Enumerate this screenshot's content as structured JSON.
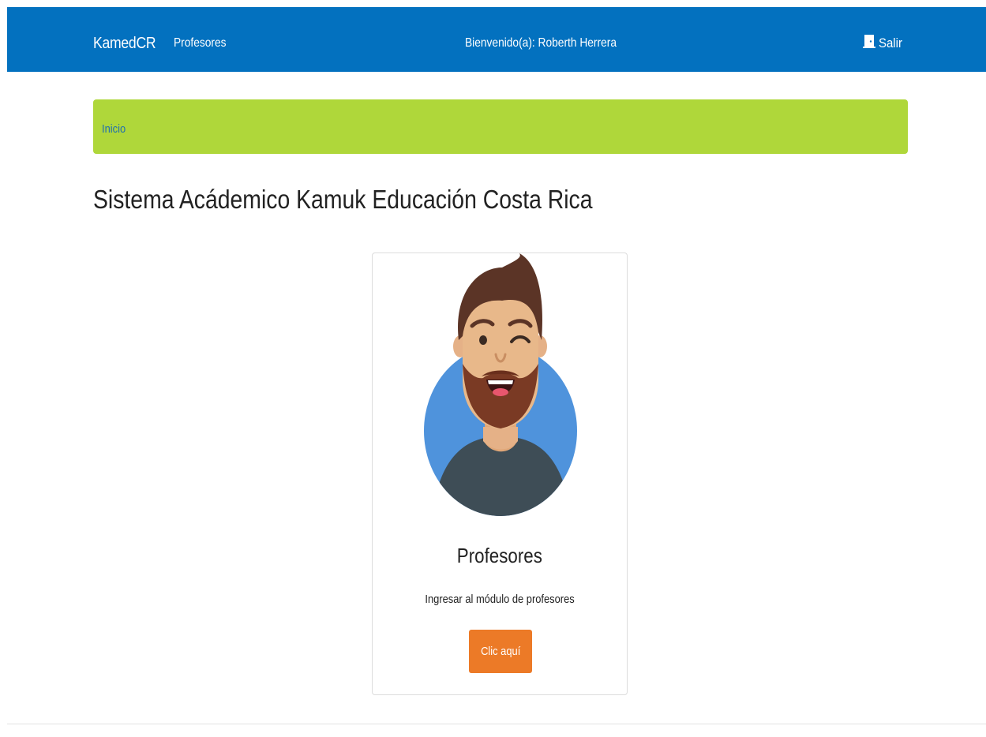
{
  "navbar": {
    "brand": "KamedCR",
    "link": "Profesores",
    "welcome": "Bienvenido(a): Roberth Herrera",
    "logout_label": "Salir",
    "logout_icon": "door-exit-icon",
    "color": "#0371bf"
  },
  "breadcrumb": {
    "item": "Inicio",
    "color": "#afd73a"
  },
  "page": {
    "title": "Sistema Acádemico Kamuk Educación Costa Rica"
  },
  "card": {
    "image": "teacher-avatar",
    "title": "Profesores",
    "text": "Ingresar al módulo de profesores",
    "button_label": "Clic aquí",
    "button_color": "#ec7a27"
  }
}
